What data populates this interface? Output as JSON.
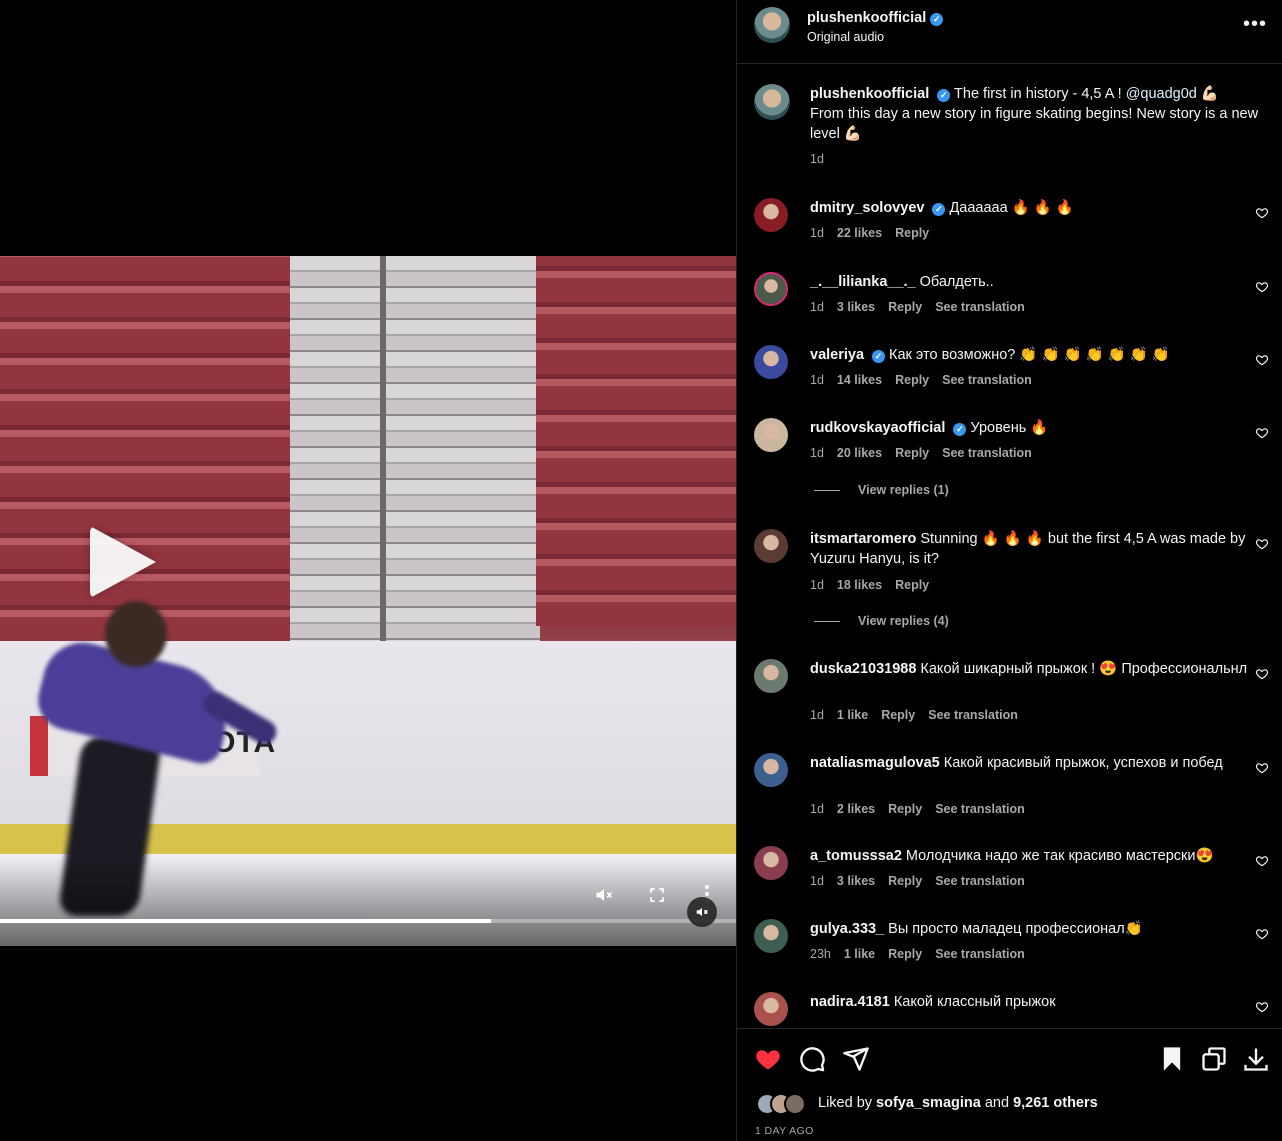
{
  "post": {
    "author": "plushenkoofficial",
    "audio": "Original audio",
    "caption_part1": "The first in history - 4,5 A ! ",
    "caption_mention": "@quadg0d",
    "caption_emoji1": " 💪🏻",
    "caption_part2": "From this day a new story in figure skating begins! New story is a new level ",
    "caption_emoji2": "💪🏻",
    "age": "1d",
    "more_glyph": "•••"
  },
  "comments": [
    {
      "user": "dmitry_solovyev",
      "verified": true,
      "text": "Дааааaa 🔥 🔥 🔥",
      "age": "1d",
      "likes": "22 likes",
      "reply": "Reply",
      "translate": ""
    },
    {
      "user": "_.__lilianka__._",
      "verified": false,
      "text": "Обалдеть..",
      "age": "1d",
      "likes": "3 likes",
      "reply": "Reply",
      "translate": "See translation"
    },
    {
      "user": "valeriya",
      "verified": true,
      "text": "Как это возможно? 👏 👏 👏 👏 👏 👏 👏",
      "age": "1d",
      "likes": "14 likes",
      "reply": "Reply",
      "translate": "See translation"
    },
    {
      "user": "rudkovskayaofficial",
      "verified": true,
      "text": "Уровень 🔥",
      "age": "1d",
      "likes": "20 likes",
      "reply": "Reply",
      "translate": "See translation",
      "view_replies": "View replies (1)"
    },
    {
      "user": "itsmartaromero",
      "verified": false,
      "text": "Stunning 🔥 🔥 🔥  but the first 4,5 A was made by Yuzuru Hanyu, is it?",
      "age": "1d",
      "likes": "18 likes",
      "reply": "Reply",
      "translate": "",
      "view_replies": "View replies (4)"
    },
    {
      "user": "duska21031988",
      "verified": false,
      "text": "Какой шикарный прыжок ! 😍 Профессиональнл",
      "age": "1d",
      "likes": "1 like",
      "reply": "Reply",
      "translate": "See translation"
    },
    {
      "user": "nataliasmagulova5",
      "verified": false,
      "text": "Какой красивый прыжок, успехов и побед",
      "age": "1d",
      "likes": "2 likes",
      "reply": "Reply",
      "translate": "See translation"
    },
    {
      "user": "a_tomusssa2",
      "verified": false,
      "text": "Молодчика надо же так красиво мастерски😍",
      "age": "1d",
      "likes": "3 likes",
      "reply": "Reply",
      "translate": "See translation"
    },
    {
      "user": "gulya.333_",
      "verified": false,
      "text": "Вы просто маладец профессионал👏",
      "age": "23h",
      "likes": "1 like",
      "reply": "Reply",
      "translate": "See translation"
    },
    {
      "user": "nadira.4181",
      "verified": false,
      "text": "Какой классный прыжок",
      "age": "",
      "likes": "",
      "reply": "",
      "translate": ""
    }
  ],
  "actions": {
    "liked_prefix": "Liked by ",
    "liked_user": "sofya_smagina",
    "liked_mid": " and ",
    "liked_count": "9,261 others",
    "timestamp": "1 DAY AGO"
  },
  "video": {
    "ad_text": "TOYOTA",
    "progress": 0.667,
    "muted": true
  },
  "colors": {
    "like_red": "#ff3040",
    "verified_blue": "#3897f0",
    "muted_text": "#a8a8a8"
  },
  "icons": [
    "play-icon",
    "mute-icon",
    "fullscreen-icon",
    "more-vertical-icon",
    "verified-icon",
    "heart-icon",
    "comment-icon",
    "share-icon",
    "bookmark-icon",
    "copy-icon",
    "download-icon"
  ]
}
